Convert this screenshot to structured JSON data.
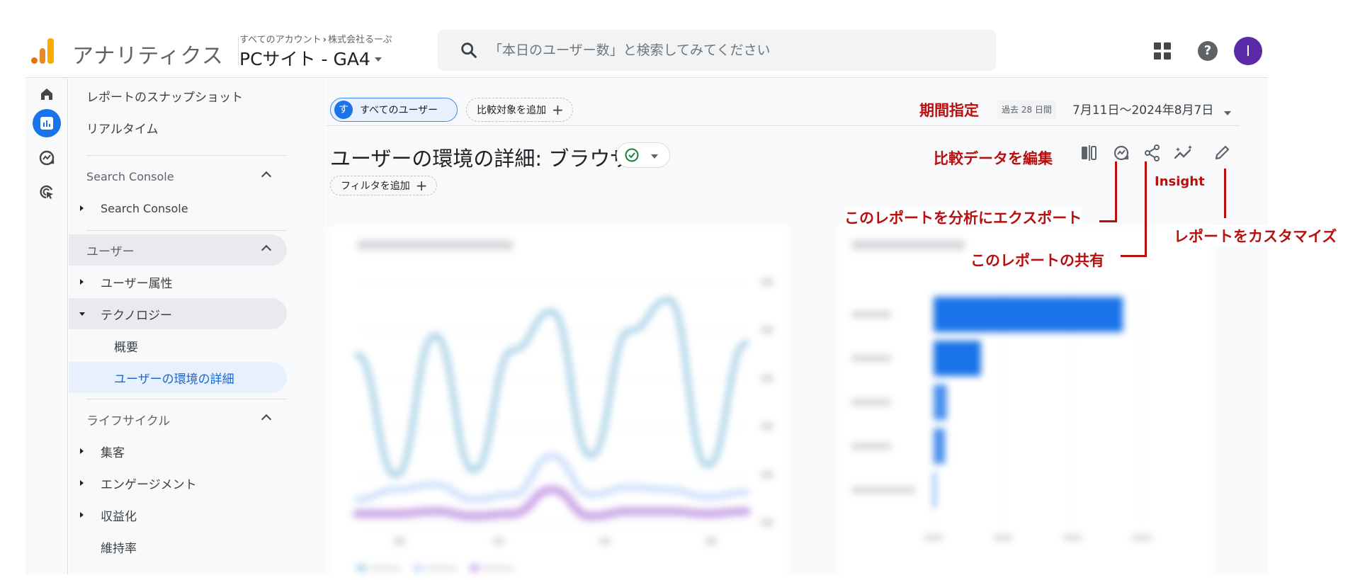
{
  "header": {
    "app_name": "アナリティクス",
    "breadcrumb": {
      "account": "すべてのアカウント",
      "separator": "›",
      "org": "株式会社るーぷ"
    },
    "property": "PCサイト - GA4",
    "search_placeholder": "「本日のユーザー数」と検索してみてください",
    "avatar_initial": "I",
    "help_glyph": "?",
    "icons": [
      "apps-icon",
      "help-icon",
      "avatar"
    ]
  },
  "rail": {
    "items": [
      {
        "name": "home",
        "icon": "home-icon",
        "active": false
      },
      {
        "name": "reports",
        "icon": "reports-icon",
        "active": true
      },
      {
        "name": "explore",
        "icon": "explore-icon",
        "active": false
      },
      {
        "name": "advertising",
        "icon": "advertising-icon",
        "active": false
      }
    ]
  },
  "sidenav": {
    "top_items": [
      "レポートのスナップショット",
      "リアルタイム"
    ],
    "sections": [
      {
        "title": "Search Console",
        "items": [
          {
            "label": "Search Console",
            "expandable": true
          }
        ]
      },
      {
        "title": "ユーザー",
        "items": [
          {
            "label": "ユーザー属性",
            "expandable": true,
            "expanded": false
          },
          {
            "label": "テクノロジー",
            "expandable": true,
            "expanded": true,
            "children": [
              {
                "label": "概要"
              },
              {
                "label": "ユーザーの環境の詳細",
                "selected": true
              }
            ]
          }
        ]
      },
      {
        "title": "ライフサイクル",
        "items": [
          {
            "label": "集客",
            "expandable": true
          },
          {
            "label": "エンゲージメント",
            "expandable": true
          },
          {
            "label": "収益化",
            "expandable": true
          },
          {
            "label": "維持率",
            "expandable": false
          }
        ]
      }
    ]
  },
  "main": {
    "segment_badge": "す",
    "segment_label": "すべてのユーザー",
    "add_comparison": "比較対象を追加",
    "date_badge": "過去 28 日間",
    "date_range": "7月11日～2024年8月7日",
    "page_title": "ユーザーの環境の詳細: ブラウザ",
    "add_filter": "フィルタを追加",
    "plus": "+",
    "toolbar": [
      "compare-icon",
      "explore-export-icon",
      "share-icon",
      "insights-icon",
      "edit-icon"
    ]
  },
  "annotations": {
    "date": "期間指定",
    "edit_comparison": "比較データを編集",
    "export": "このレポートを分析にエクスポート",
    "share": "このレポートの共有",
    "insight": "Insight",
    "customize": "レポートをカスタマイズ",
    "color": "#b80f0f"
  },
  "colors": {
    "accent": "#1a73e8",
    "avatar": "#5b2aa6",
    "logo_orange": "#e37400",
    "logo_yellow": "#f9ab00"
  },
  "chart_data": [
    {
      "type": "line",
      "title": "",
      "note": "blurred in screenshot; relative shape only",
      "series": [
        {
          "name": "series-1",
          "color": "#a8d0e6",
          "values": [
            70,
            20,
            78,
            22,
            72,
            88,
            28,
            80,
            93,
            24,
            75
          ]
        },
        {
          "name": "series-2",
          "color": "#c6dafc",
          "values": [
            10,
            14,
            16,
            10,
            12,
            28,
            12,
            15,
            14,
            11,
            13
          ]
        },
        {
          "name": "series-3",
          "color": "#c9a7e6",
          "values": [
            4,
            4,
            5,
            3,
            4,
            14,
            3,
            5,
            5,
            4,
            5
          ]
        }
      ],
      "ylim": [
        0,
        100
      ]
    },
    {
      "type": "bar",
      "title": "",
      "note": "blurred in screenshot; relative magnitudes only",
      "categories": [
        "",
        "",
        "",
        "",
        ""
      ],
      "values": [
        100,
        25,
        7,
        6,
        1
      ],
      "color": "#1a73e8",
      "ylim": [
        0,
        110
      ]
    }
  ]
}
